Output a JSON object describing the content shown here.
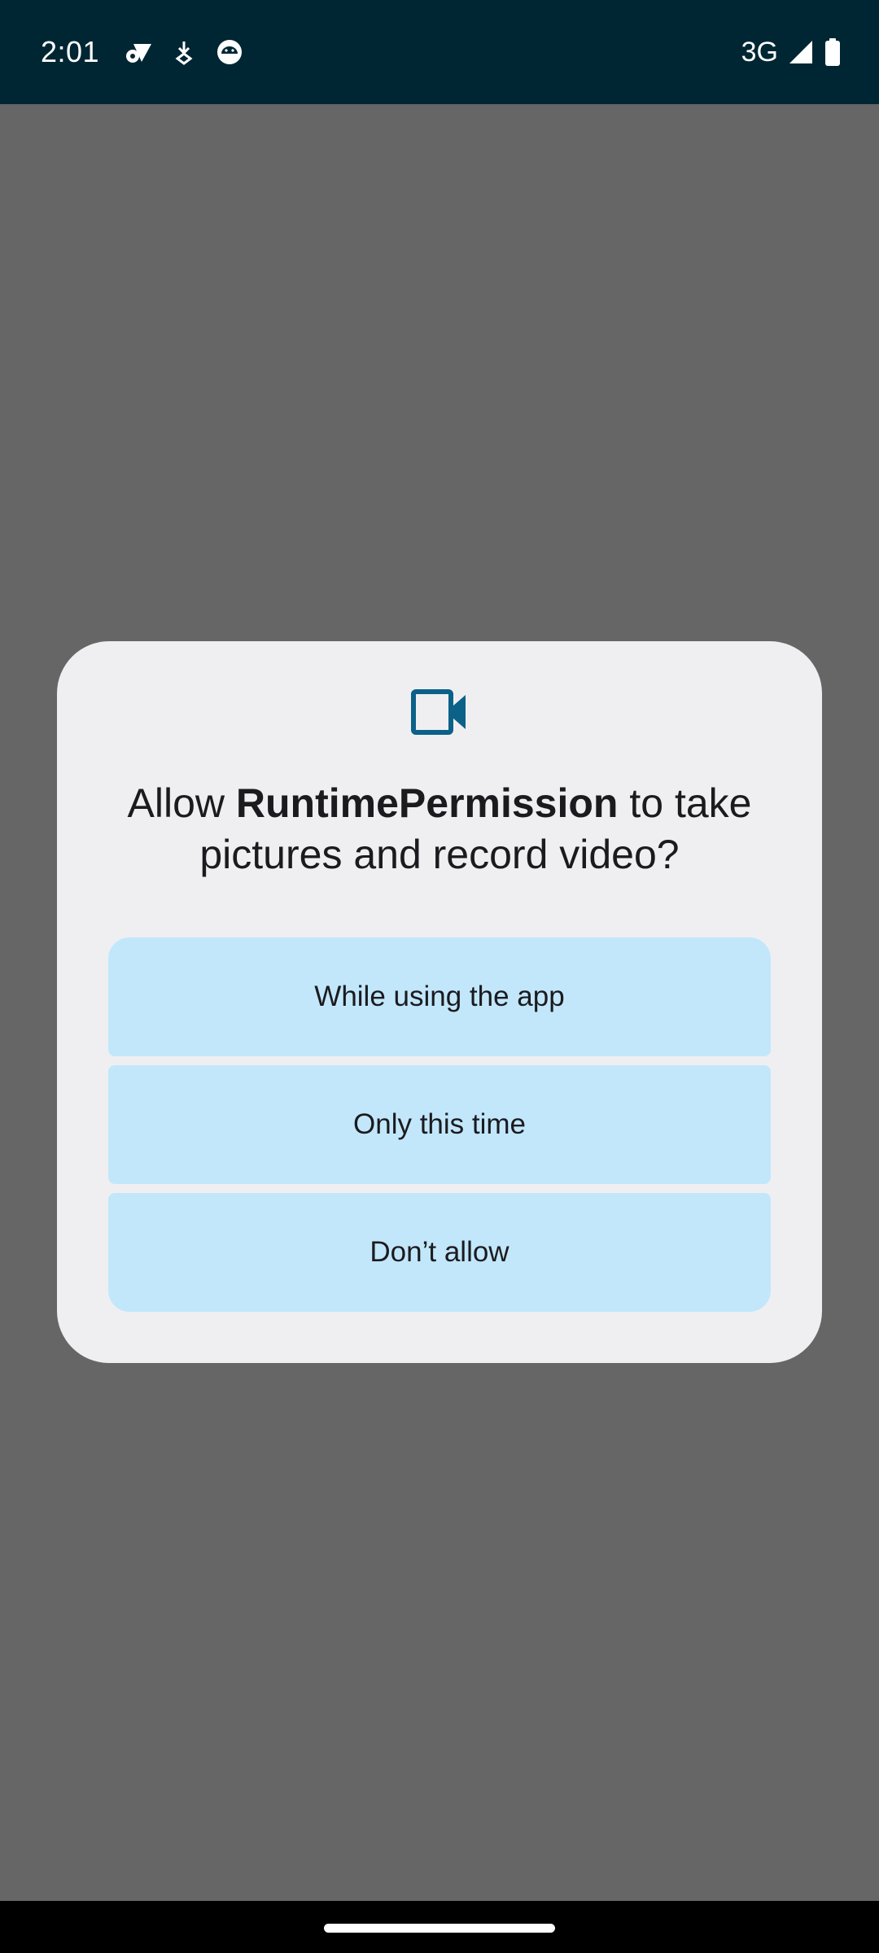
{
  "status_bar": {
    "time": "2:01",
    "network": "3G",
    "icons": [
      "settings-wifi-icon",
      "download-icon",
      "android-head-icon",
      "cell-signal-icon",
      "battery-icon"
    ]
  },
  "dialog": {
    "icon": "videocam-icon",
    "title_prefix": "Allow ",
    "app_name": "RuntimePermission",
    "title_suffix": " to take pictures and record video?",
    "buttons": [
      {
        "label": "While using the app"
      },
      {
        "label": "Only this time"
      },
      {
        "label": "Don’t allow"
      }
    ]
  },
  "colors": {
    "status_bar_bg": "#002633",
    "scrim": "#666666",
    "dialog_bg": "#efeff2",
    "button_bg": "#c2e7fb",
    "accent_icon": "#0b6188",
    "text": "#1b1b1f"
  }
}
